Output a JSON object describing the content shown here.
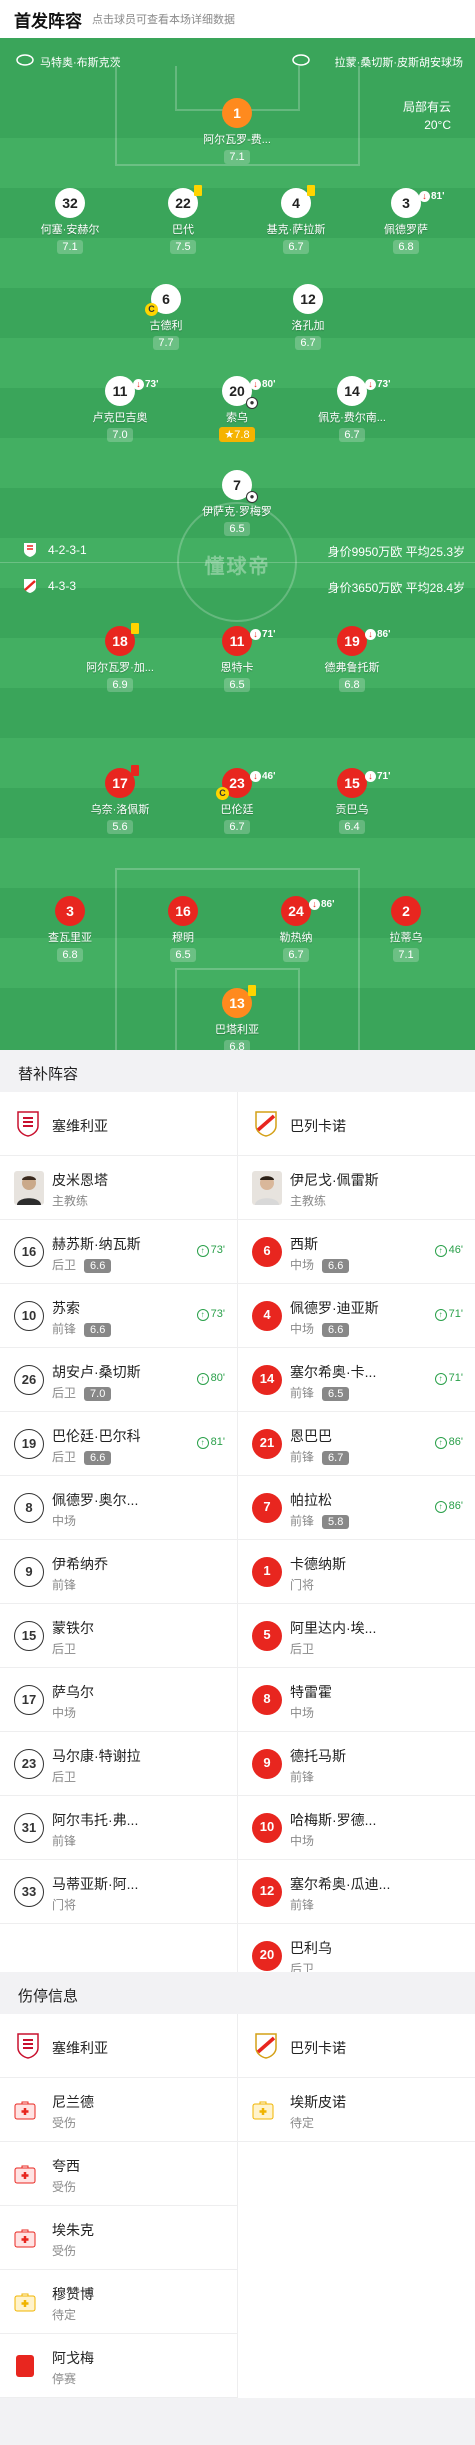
{
  "header": {
    "title": "首发阵容",
    "subtitle": "点击球员可查看本场详细数据"
  },
  "pitch": {
    "home_stadium": "马特奥·布斯克茨",
    "away_stadium": "拉蒙·桑切斯·皮斯胡安球场",
    "weather": "局部有云",
    "temperature": "20°C",
    "watermark": "懂球帝",
    "home_formation": "4-2-3-1",
    "home_value": "身价9950万欧 平均25.3岁",
    "away_formation": "4-3-3",
    "away_value": "身价3650万欧 平均28.4岁",
    "home_players": [
      {
        "num": "1",
        "name": "阿尔瓦罗-费...",
        "rating": "7.1",
        "type": "gk"
      },
      {
        "num": "32",
        "name": "何塞·安赫尔",
        "rating": "7.1",
        "type": "home"
      },
      {
        "num": "22",
        "name": "巴代",
        "rating": "7.5",
        "type": "home",
        "card": "yellow"
      },
      {
        "num": "4",
        "name": "基克·萨拉斯",
        "rating": "6.7",
        "type": "home",
        "card": "yellow"
      },
      {
        "num": "3",
        "name": "佩德罗萨",
        "rating": "6.8",
        "type": "home",
        "sub": "81'"
      },
      {
        "num": "6",
        "name": "古德利",
        "rating": "7.7",
        "type": "home",
        "captain": "C"
      },
      {
        "num": "12",
        "name": "洛孔加",
        "rating": "6.7",
        "type": "home"
      },
      {
        "num": "11",
        "name": "卢克巴吉奥",
        "rating": "7.0",
        "type": "home",
        "sub": "73'"
      },
      {
        "num": "20",
        "name": "索乌",
        "rating": "7.8",
        "type": "home",
        "sub": "80'",
        "star": true,
        "ball": true
      },
      {
        "num": "14",
        "name": "佩克·费尔南...",
        "rating": "6.7",
        "type": "home",
        "sub": "73'"
      },
      {
        "num": "7",
        "name": "伊萨克·罗梅罗",
        "rating": "6.5",
        "type": "home",
        "ball": true
      }
    ],
    "away_players": [
      {
        "num": "18",
        "name": "阿尔瓦罗·加...",
        "rating": "6.9",
        "card": "yellow"
      },
      {
        "num": "11",
        "name": "恩特卡",
        "rating": "6.5",
        "sub": "71'"
      },
      {
        "num": "19",
        "name": "德弗鲁托斯",
        "rating": "6.8",
        "sub": "86'"
      },
      {
        "num": "17",
        "name": "乌奈·洛佩斯",
        "rating": "5.6",
        "card": "red"
      },
      {
        "num": "23",
        "name": "巴伦廷",
        "rating": "6.7",
        "sub": "46'",
        "captain": "C"
      },
      {
        "num": "15",
        "name": "贡巴乌",
        "rating": "6.4",
        "sub": "71'"
      },
      {
        "num": "3",
        "name": "查瓦里亚",
        "rating": "6.8"
      },
      {
        "num": "16",
        "name": "穆明",
        "rating": "6.5"
      },
      {
        "num": "24",
        "name": "勒热纳",
        "rating": "6.7",
        "sub": "86'"
      },
      {
        "num": "2",
        "name": "拉蒂乌",
        "rating": "7.1"
      },
      {
        "num": "13",
        "name": "巴塔利亚",
        "rating": "6.8",
        "type": "gk",
        "card": "yellow"
      }
    ]
  },
  "subs": {
    "title": "替补阵容",
    "home_team": "塞维利亚",
    "away_team": "巴列卡诺",
    "home_coach": {
      "name": "皮米恩塔",
      "role": "主教练"
    },
    "away_coach": {
      "name": "伊尼戈·佩雷斯",
      "role": "主教练"
    },
    "home": [
      {
        "num": "16",
        "name": "赫苏斯·纳瓦斯",
        "pos": "后卫",
        "rating": "6.6",
        "time": "73'"
      },
      {
        "num": "10",
        "name": "苏索",
        "pos": "前锋",
        "rating": "6.6",
        "time": "73'"
      },
      {
        "num": "26",
        "name": "胡安卢·桑切斯",
        "pos": "后卫",
        "rating": "7.0",
        "time": "80'"
      },
      {
        "num": "19",
        "name": "巴伦廷·巴尔科",
        "pos": "后卫",
        "rating": "6.6",
        "time": "81'"
      },
      {
        "num": "8",
        "name": "佩德罗·奥尔...",
        "pos": "中场"
      },
      {
        "num": "9",
        "name": "伊希纳乔",
        "pos": "前锋"
      },
      {
        "num": "15",
        "name": "蒙铁尔",
        "pos": "后卫"
      },
      {
        "num": "17",
        "name": "萨乌尔",
        "pos": "中场"
      },
      {
        "num": "23",
        "name": "马尔康·特谢拉",
        "pos": "后卫"
      },
      {
        "num": "31",
        "name": "阿尔韦托·弗...",
        "pos": "前锋"
      },
      {
        "num": "33",
        "name": "马蒂亚斯·阿...",
        "pos": "门将"
      }
    ],
    "away": [
      {
        "num": "6",
        "name": "西斯",
        "pos": "中场",
        "rating": "6.6",
        "time": "46'"
      },
      {
        "num": "4",
        "name": "佩德罗·迪亚斯",
        "pos": "中场",
        "rating": "6.6",
        "time": "71'"
      },
      {
        "num": "14",
        "name": "塞尔希奥·卡...",
        "pos": "前锋",
        "rating": "6.5",
        "time": "71'"
      },
      {
        "num": "21",
        "name": "恩巴巴",
        "pos": "前锋",
        "rating": "6.7",
        "time": "86'"
      },
      {
        "num": "7",
        "name": "帕拉松",
        "pos": "前锋",
        "rating": "5.8",
        "time": "86'"
      },
      {
        "num": "1",
        "name": "卡德纳斯",
        "pos": "门将"
      },
      {
        "num": "5",
        "name": "阿里达内·埃...",
        "pos": "后卫"
      },
      {
        "num": "8",
        "name": "特雷霍",
        "pos": "中场"
      },
      {
        "num": "9",
        "name": "德托马斯",
        "pos": "前锋"
      },
      {
        "num": "10",
        "name": "哈梅斯·罗德...",
        "pos": "中场"
      },
      {
        "num": "12",
        "name": "塞尔希奥·瓜迪...",
        "pos": "前锋"
      },
      {
        "num": "20",
        "name": "巴利乌",
        "pos": "后卫"
      }
    ]
  },
  "injuries": {
    "title": "伤停信息",
    "home_team": "塞维利亚",
    "away_team": "巴列卡诺",
    "home": [
      {
        "name": "尼兰德",
        "status": "受伤",
        "icon": "injury-icon"
      },
      {
        "name": "夸西",
        "status": "受伤",
        "icon": "injury-icon"
      },
      {
        "name": "埃朱克",
        "status": "受伤",
        "icon": "injury-icon"
      },
      {
        "name": "穆赞博",
        "status": "待定",
        "icon": "doubtful-icon"
      },
      {
        "name": "阿戈梅",
        "status": "停赛",
        "icon": "red-card-icon"
      }
    ],
    "away": [
      {
        "name": "埃斯皮诺",
        "status": "待定",
        "icon": "doubtful-icon"
      }
    ]
  },
  "colors": {
    "pitch": "#3aa55a",
    "accent_red": "#e8261f",
    "gk_orange": "#ff8a1e",
    "sub_green": "#2aa04a"
  }
}
